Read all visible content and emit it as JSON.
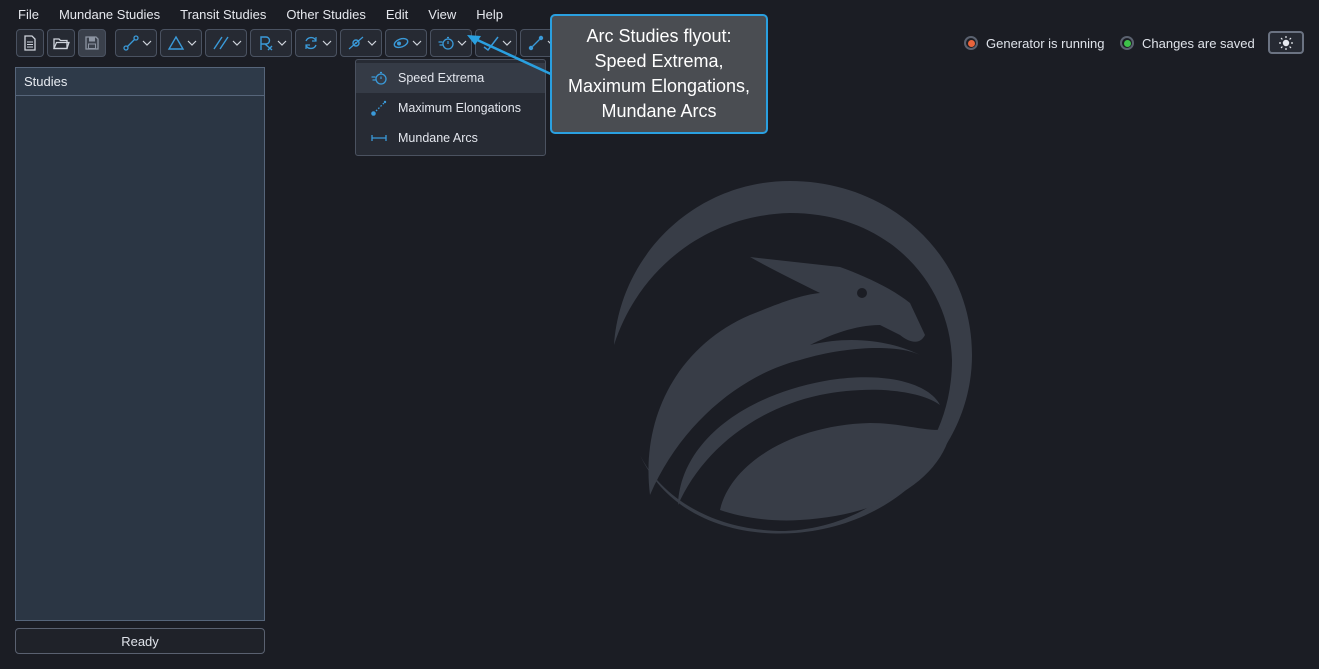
{
  "menu": {
    "items": [
      "File",
      "Mundane Studies",
      "Transit Studies",
      "Other Studies",
      "Edit",
      "View",
      "Help"
    ]
  },
  "toolbar": {
    "buttons": [
      {
        "icon": "new-file-icon",
        "type": "single"
      },
      {
        "icon": "open-folder-icon",
        "type": "single"
      },
      {
        "icon": "save-icon",
        "type": "single",
        "disabled": true
      },
      {
        "icon": "aspect-line-icon",
        "type": "dropdown"
      },
      {
        "icon": "triangle-icon",
        "type": "dropdown"
      },
      {
        "icon": "parallel-lines-icon",
        "type": "dropdown"
      },
      {
        "icon": "retrograde-rx-icon",
        "type": "dropdown"
      },
      {
        "icon": "cycle-icon",
        "type": "dropdown"
      },
      {
        "icon": "orbit-target-icon",
        "type": "dropdown"
      },
      {
        "icon": "eclipse-icon",
        "type": "dropdown"
      },
      {
        "icon": "speed-arc-icon",
        "type": "dropdown",
        "open": true
      },
      {
        "icon": "check-arc-icon",
        "type": "dropdown"
      },
      {
        "icon": "node-line-icon",
        "type": "dropdown"
      },
      {
        "icon": "save-disk-teal-icon",
        "type": "single"
      }
    ]
  },
  "status": {
    "generator": {
      "label": "Generator is running",
      "color": "#e8643c"
    },
    "changes": {
      "label": "Changes are saved",
      "color": "#3ec24a"
    }
  },
  "theme_toggle": {
    "icon": "sun-icon"
  },
  "panel": {
    "title": "Studies"
  },
  "status_bar": {
    "text": "Ready"
  },
  "flyout": {
    "items": [
      {
        "label": "Speed Extrema",
        "icon": "stopwatch-icon"
      },
      {
        "label": "Maximum Elongations",
        "icon": "dotted-line-icon"
      },
      {
        "label": "Mundane Arcs",
        "icon": "arc-span-icon"
      }
    ]
  },
  "callout": {
    "text": "Arc Studies flyout:\nSpeed Extrema,\nMaximum Elongations,\nMundane Arcs"
  },
  "colors": {
    "accent": "#2aa0e0",
    "background": "#1b1d24",
    "panel": "#2b3644",
    "logo": "#383d47"
  }
}
